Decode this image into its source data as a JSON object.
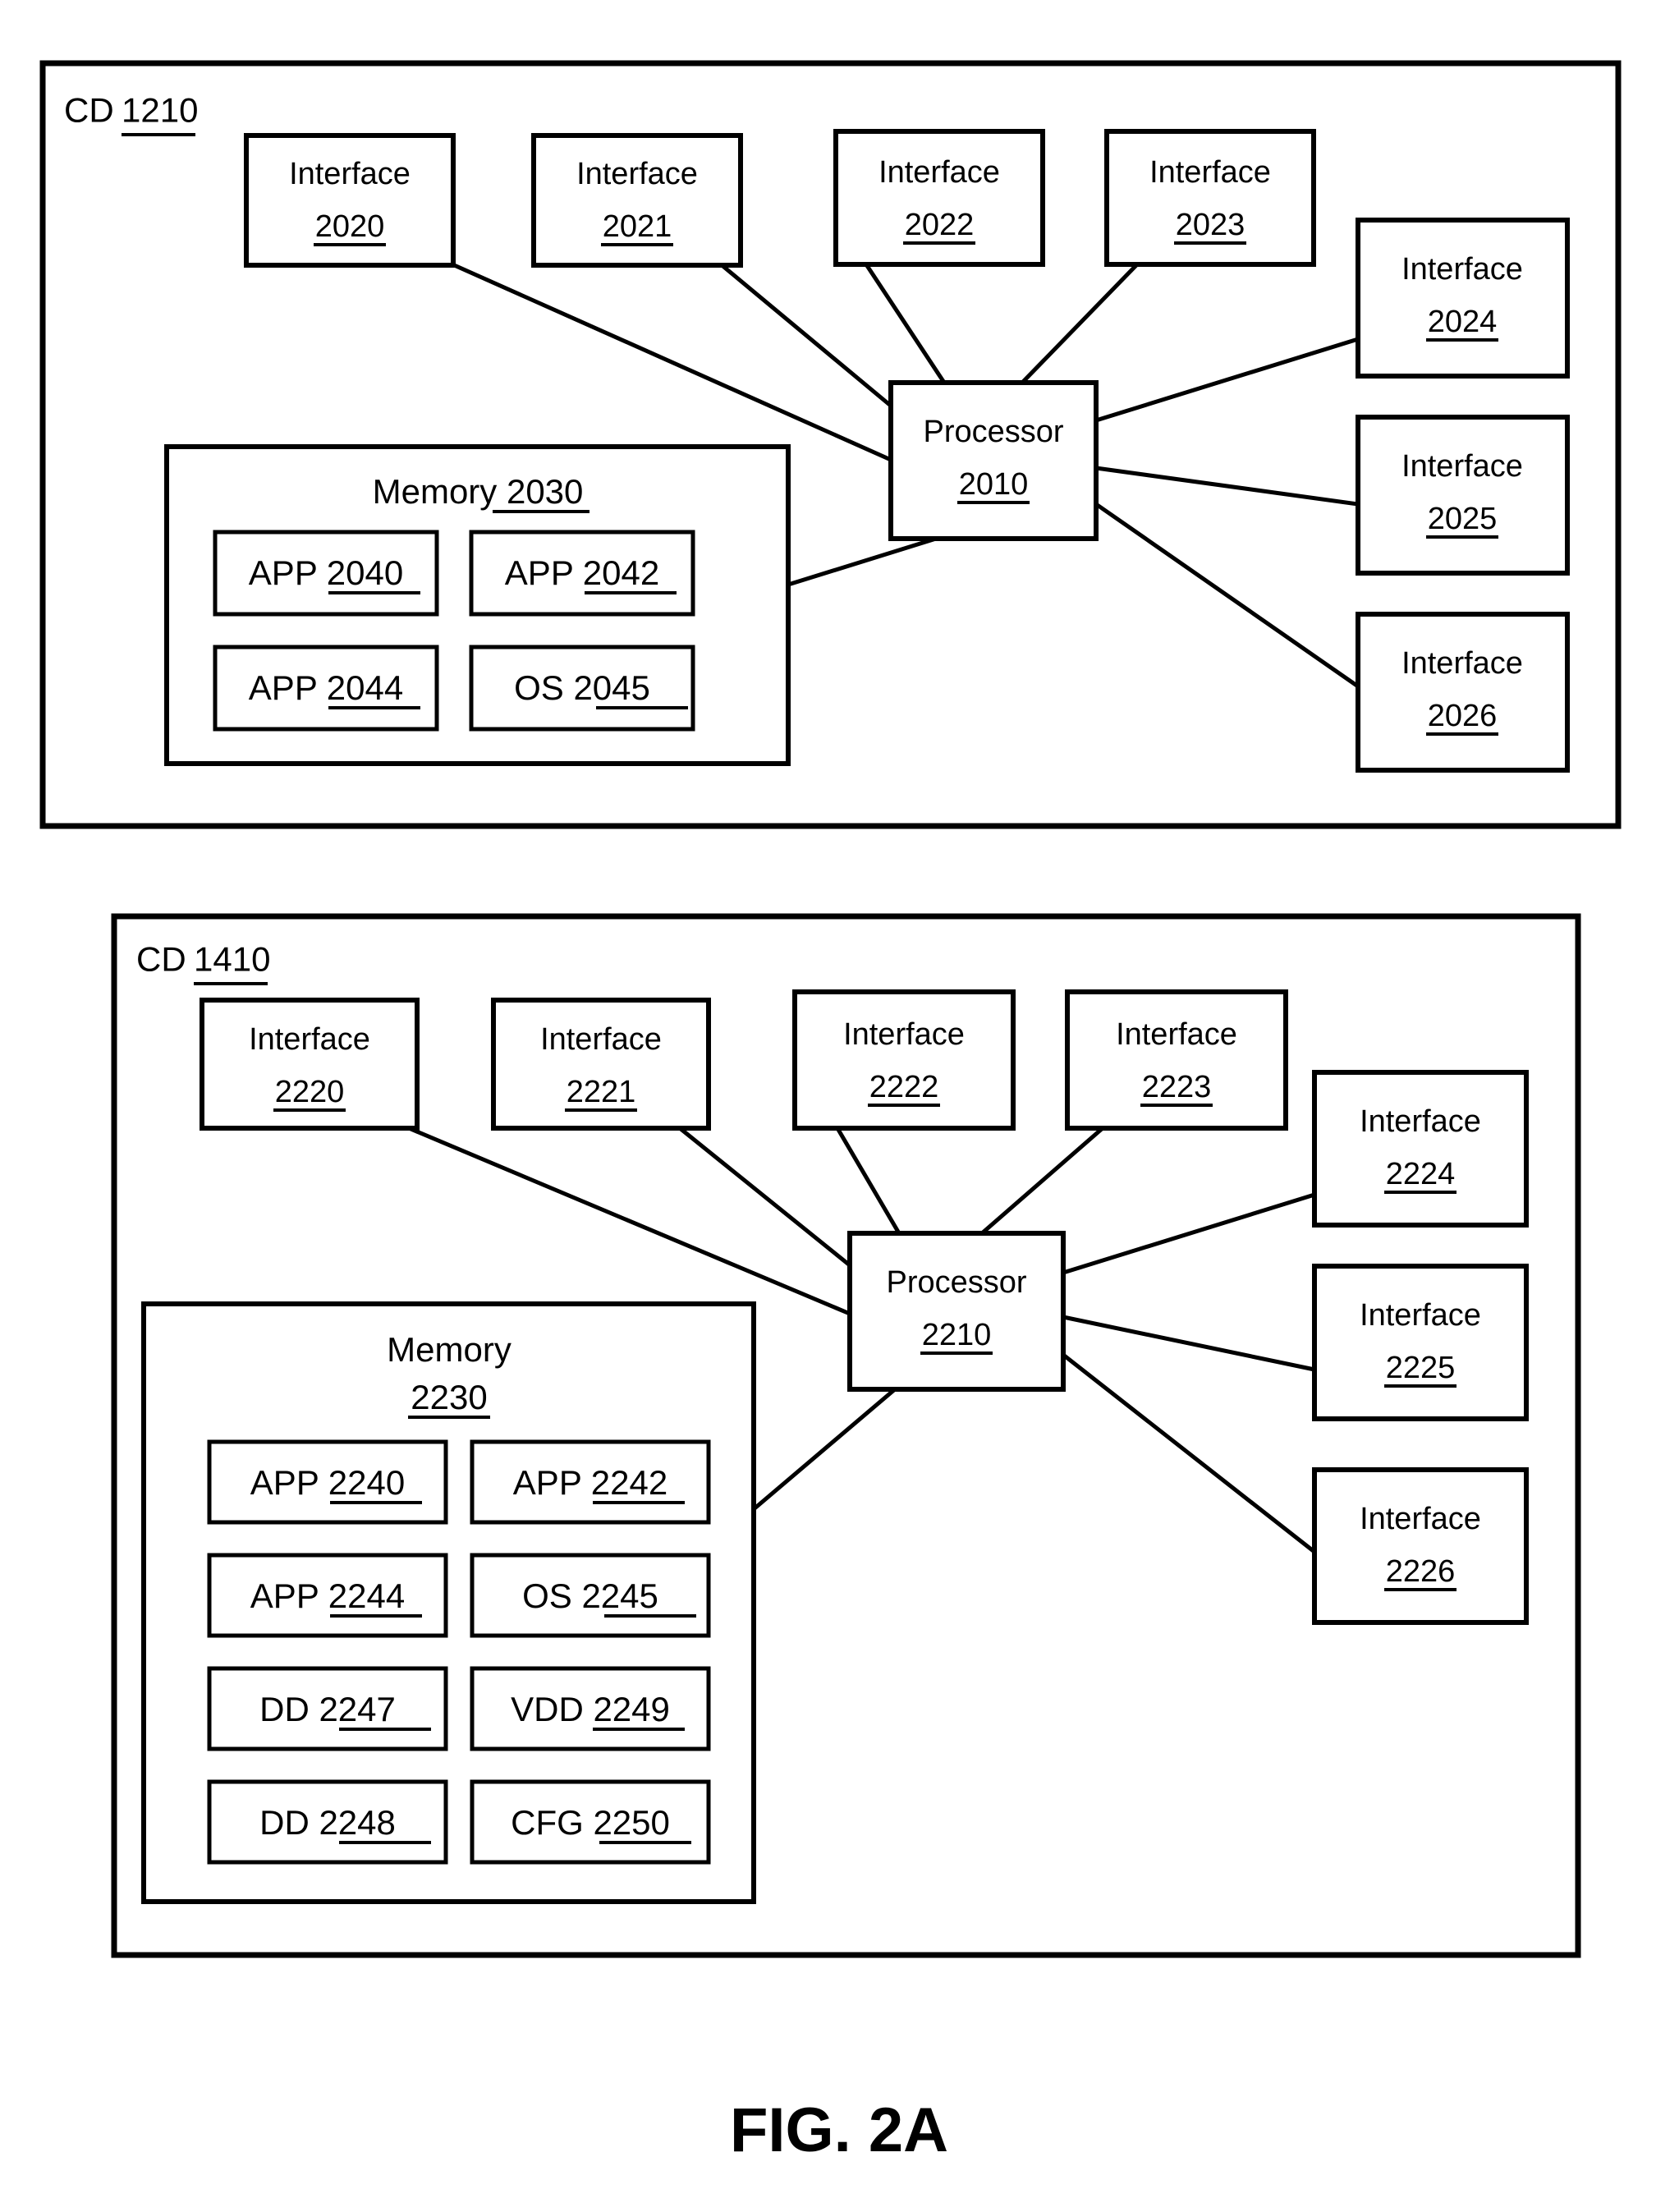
{
  "figure": {
    "caption": "FIG. 2A"
  },
  "diagram_top": {
    "frame_label_prefix": "CD ",
    "frame_label_ref": "1210",
    "processor": {
      "line1": "Processor",
      "line2": "2010"
    },
    "memory": {
      "title": "Memory",
      "ref": "2030",
      "title_inline": "Memory 2030",
      "blocks": [
        {
          "label": "APP",
          "ref": "2040"
        },
        {
          "label": "APP",
          "ref": "2042"
        },
        {
          "label": "APP",
          "ref": "2044"
        },
        {
          "label": "OS",
          "ref": "2045"
        }
      ]
    },
    "interfaces_top": [
      {
        "line1": "Interface",
        "line2": "2020"
      },
      {
        "line1": "Interface",
        "line2": "2021"
      },
      {
        "line1": "Interface",
        "line2": "2022"
      },
      {
        "line1": "Interface",
        "line2": "2023"
      }
    ],
    "interfaces_right": [
      {
        "line1": "Interface",
        "line2": "2024"
      },
      {
        "line1": "Interface",
        "line2": "2025"
      },
      {
        "line1": "Interface",
        "line2": "2026"
      }
    ]
  },
  "diagram_bottom": {
    "frame_label_prefix": "CD ",
    "frame_label_ref": "1410",
    "processor": {
      "line1": "Processor",
      "line2": "2210"
    },
    "memory": {
      "title": "Memory",
      "ref": "2230",
      "blocks": [
        {
          "label": "APP",
          "ref": "2240"
        },
        {
          "label": "APP",
          "ref": "2242"
        },
        {
          "label": "APP",
          "ref": "2244"
        },
        {
          "label": "OS",
          "ref": "2245"
        },
        {
          "label": "DD",
          "ref": "2247"
        },
        {
          "label": "VDD",
          "ref": "2249"
        },
        {
          "label": "DD",
          "ref": "2248"
        },
        {
          "label": "CFG",
          "ref": "2250"
        }
      ]
    },
    "interfaces_top": [
      {
        "line1": "Interface",
        "line2": "2220"
      },
      {
        "line1": "Interface",
        "line2": "2221"
      },
      {
        "line1": "Interface",
        "line2": "2222"
      },
      {
        "line1": "Interface",
        "line2": "2223"
      }
    ],
    "interfaces_right": [
      {
        "line1": "Interface",
        "line2": "2224"
      },
      {
        "line1": "Interface",
        "line2": "2225"
      },
      {
        "line1": "Interface",
        "line2": "2226"
      }
    ]
  },
  "style": {
    "ink": "#000000",
    "paper": "#ffffff"
  }
}
